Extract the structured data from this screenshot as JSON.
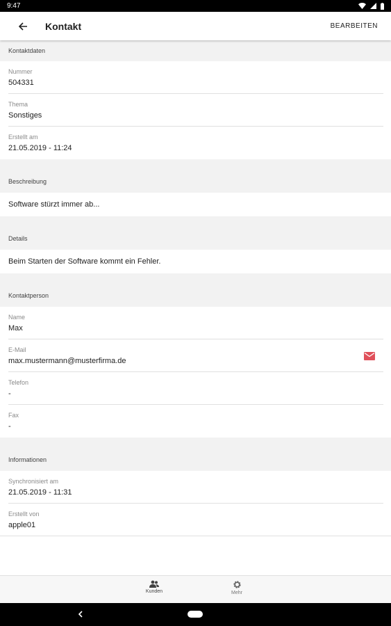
{
  "status_bar": {
    "time": "9:47"
  },
  "app_bar": {
    "title": "Kontakt",
    "edit_label": "BEARBEITEN"
  },
  "sections": {
    "contact_data": {
      "header": "Kontaktdaten",
      "fields": [
        {
          "label": "Nummer",
          "value": "504331"
        },
        {
          "label": "Thema",
          "value": "Sonstiges"
        },
        {
          "label": "Erstellt am",
          "value": "21.05.2019 - 11:24"
        }
      ]
    },
    "description": {
      "header": "Beschreibung",
      "text": "Software stürzt immer ab..."
    },
    "details": {
      "header": "Details",
      "text": "Beim Starten der Software kommt ein Fehler."
    },
    "contact_person": {
      "header": "Kontaktperson",
      "fields": [
        {
          "label": "Name",
          "value": "Max"
        },
        {
          "label": "E-Mail",
          "value": "max.mustermann@musterfirma.de"
        },
        {
          "label": "Telefon",
          "value": "-"
        },
        {
          "label": "Fax",
          "value": "-"
        }
      ]
    },
    "information": {
      "header": "Informationen",
      "fields": [
        {
          "label": "Synchronisiert am",
          "value": "21.05.2019 - 11:31"
        },
        {
          "label": "Erstellt von",
          "value": "apple01"
        }
      ]
    }
  },
  "bottom_nav": {
    "items": [
      {
        "label": "Kunden",
        "icon": "people-icon"
      },
      {
        "label": "Mehr",
        "icon": "gear-icon"
      }
    ]
  },
  "colors": {
    "mail_icon": "#e0505a",
    "section_bg": "#f2f2f2"
  }
}
